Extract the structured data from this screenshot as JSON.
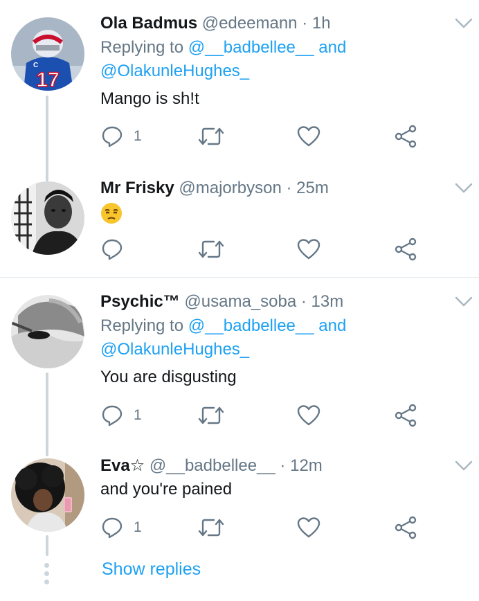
{
  "replies": [
    {
      "name": "Ola Badmus",
      "handle": "@edeemann",
      "dot": "·",
      "time": "1h",
      "replying_prefix": "Replying to",
      "replying_mention_1": "@__badbellee__",
      "replying_and": "and",
      "replying_mention_2": "@OlakunleHughes_",
      "text": "Mango is sh!t",
      "reply_count": "1",
      "avatar_icon": "football-player-avatar"
    },
    {
      "name": "Mr Frisky",
      "handle": "@majorbyson",
      "dot": "·",
      "time": "25m",
      "text": "😒",
      "reply_count": "",
      "avatar_icon": "person-bw-avatar"
    },
    {
      "name": "Psychic™",
      "handle": "@usama_soba",
      "dot": "·",
      "time": "13m",
      "replying_prefix": "Replying to",
      "replying_mention_1": "@__badbellee__",
      "replying_and": "and",
      "replying_mention_2": "@OlakunleHughes_",
      "text": "You are disgusting",
      "reply_count": "1",
      "avatar_icon": "grayscale-face-avatar"
    },
    {
      "name": "Eva☆",
      "handle": "@__badbellee__",
      "dot": "·",
      "time": "12m",
      "text": "and you're pained",
      "reply_count": "1",
      "avatar_icon": "afro-woman-avatar"
    }
  ],
  "show_replies_label": "Show replies",
  "colors": {
    "link": "#1da1f2",
    "secondary_text": "#657786",
    "thread_line": "#cdd5dc",
    "divider": "#e1e8ed"
  }
}
